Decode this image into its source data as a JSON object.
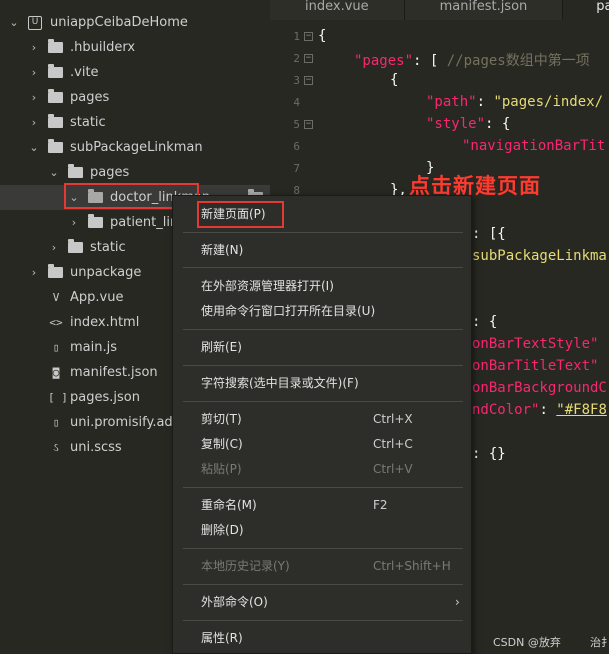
{
  "tabs": [
    "index.vue",
    "manifest.json",
    "page"
  ],
  "tree": {
    "project": "uniappCeibaDeHome",
    "items": [
      {
        "label": ".hbuilderx"
      },
      {
        "label": ".vite"
      },
      {
        "label": "pages"
      },
      {
        "label": "static"
      },
      {
        "label": "subPackageLinkman"
      },
      {
        "label": "pages"
      },
      {
        "label": "doctor_linkman"
      },
      {
        "label": "patient_link"
      },
      {
        "label": "static"
      },
      {
        "label": "unpackage"
      },
      {
        "label": "App.vue"
      },
      {
        "label": "index.html"
      },
      {
        "label": "main.js"
      },
      {
        "label": "manifest.json"
      },
      {
        "label": "pages.json"
      },
      {
        "label": "uni.promisify.adap"
      },
      {
        "label": "uni.scss"
      }
    ]
  },
  "editor": {
    "line_numbers": [
      "1",
      "2",
      "3",
      "4",
      "5",
      "6",
      "7",
      "8"
    ],
    "lines": [
      {
        "a": "{"
      },
      {
        "key": "\"pages\"",
        "rest": ": [ ",
        "comment": "//pages数组中第一项"
      },
      {
        "a": "{"
      },
      {
        "key": "\"path\"",
        "val": "\"pages/index/"
      },
      {
        "key": "\"style\"",
        "rest": ": {"
      },
      {
        "key": "\"navigationBarTit"
      },
      {
        "a": "}"
      },
      {
        "a": "},"
      }
    ],
    "frag_1": ": [{",
    "frag_2": "subPackageLinkma",
    "frag_3": ": {",
    "frag_4": "onBarTextStyle\"",
    "frag_5": "onBarTitleText\"",
    "frag_6": "onBarBackgroundC",
    "frag_7_key": "ndColor\"",
    "frag_7_val": "\"#F8F8",
    "frag_8": ": {}"
  },
  "annotation": "点击新建页面",
  "context_menu": {
    "items": [
      {
        "label": "新建页面(P)",
        "shortcut": ""
      },
      {
        "label": "新建(N)",
        "shortcut": ""
      },
      {
        "label": "在外部资源管理器打开(I)",
        "shortcut": ""
      },
      {
        "label": "使用命令行窗口打开所在目录(U)",
        "shortcut": ""
      },
      {
        "label": "刷新(E)",
        "shortcut": ""
      },
      {
        "label": "字符搜索(选中目录或文件)(F)",
        "shortcut": ""
      },
      {
        "label": "剪切(T)",
        "shortcut": "Ctrl+X"
      },
      {
        "label": "复制(C)",
        "shortcut": "Ctrl+C"
      },
      {
        "label": "粘贴(P)",
        "shortcut": "Ctrl+V"
      },
      {
        "label": "重命名(M)",
        "shortcut": "F2"
      },
      {
        "label": "删除(D)",
        "shortcut": ""
      },
      {
        "label": "本地历史记录(Y)",
        "shortcut": "Ctrl+Shift+H"
      },
      {
        "label": "外部命令(O)",
        "shortcut": ""
      },
      {
        "label": "属性(R)",
        "shortcut": ""
      }
    ]
  },
  "watermark": "CSDN @放弃",
  "watermark_right": "治扌",
  "colors": {
    "highlight": "#e53935",
    "annotation": "#ff3b30",
    "keyword": "#f92672",
    "string": "#e6db74"
  }
}
